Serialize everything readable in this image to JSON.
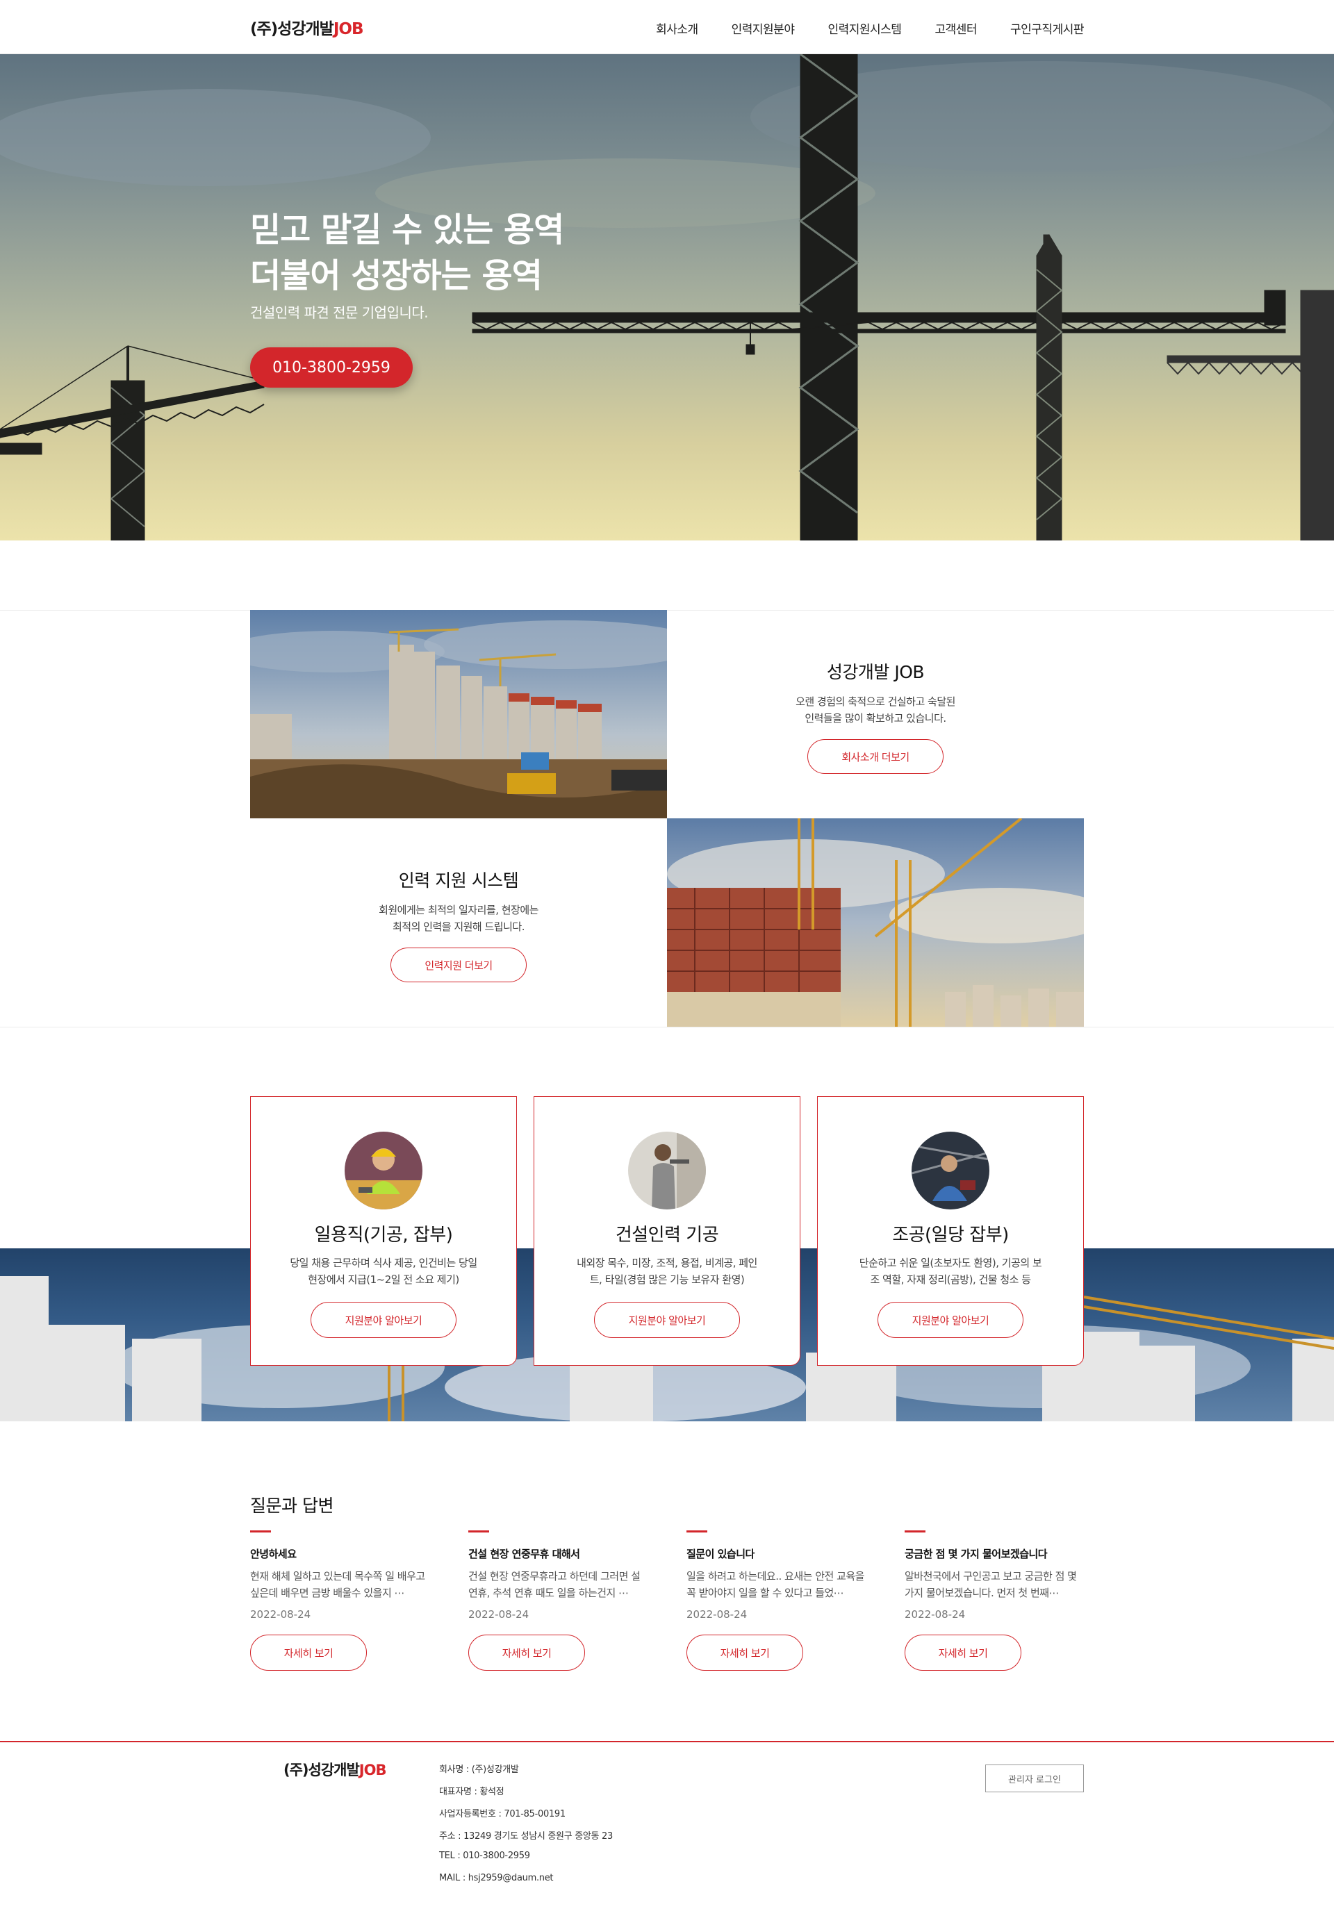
{
  "header": {
    "logo_main": "(주)성강개발",
    "logo_accent": "JOB",
    "nav": [
      "회사소개",
      "인력지원분야",
      "인력지원시스템",
      "고객센터",
      "구인구직게시판"
    ]
  },
  "hero": {
    "title_line1": "믿고 맡길 수 있는 용역",
    "title_line2": "더불어 성장하는 용역",
    "subtitle": "건설인력 파견 전문 기업입니다.",
    "phone_button": "010-3800-2959"
  },
  "intro": {
    "company": {
      "title": "성강개발 JOB",
      "line1": "오랜 경험의 축적으로 건실하고 숙달된",
      "line2": "인력들을 많이 확보하고 있습니다.",
      "button": "회사소개 더보기"
    },
    "system": {
      "title": "인력 지원 시스템",
      "line1": "회원에게는 최적의 일자리를, 현장에는",
      "line2": "최적의 인력을 지원해 드립니다.",
      "button": "인력지원 더보기"
    }
  },
  "fields": [
    {
      "title": "일용직(기공, 잡부)",
      "line1": "당일 채용 근무하며 식사 제공, 인건비는 당일",
      "line2": "현장에서 지급(1~2일 전 소요 제기)",
      "button": "지원분야 알아보기"
    },
    {
      "title": "건설인력 기공",
      "line1": "내외장 목수, 미장, 조적, 용접, 비계공, 페인",
      "line2": "트, 타일(경험 많은 기능 보유자 환영)",
      "button": "지원분야 알아보기"
    },
    {
      "title": "조공(일당 잡부)",
      "line1": "단순하고 쉬운 일(초보자도 환영), 기공의 보",
      "line2": "조 역할, 자재 정리(곰방), 건물 청소 등",
      "button": "지원분야 알아보기"
    }
  ],
  "qa": {
    "title": "질문과 답변",
    "items": [
      {
        "title": "안녕하세요",
        "body": "현재 해체 일하고 있는데 목수쪽 일 배우고 싶은데 배우면 금방 배울수 있을지 ⋯",
        "date": "2022-08-24",
        "button": "자세히 보기"
      },
      {
        "title": "건설 현장 연중무휴 대해서",
        "body": "건설 현장 연중무휴라고 하던데 그러면 설 연휴, 추석 연휴 때도 일을 하는건지 ⋯",
        "date": "2022-08-24",
        "button": "자세히 보기"
      },
      {
        "title": "질문이 있습니다",
        "body": "일을 하려고 하는데요.. 요새는 안전 교육을 꼭 받아야지 일을 할 수 있다고 들었⋯",
        "date": "2022-08-24",
        "button": "자세히 보기"
      },
      {
        "title": "궁금한 점 몇 가지 물어보겠습니다",
        "body": "알바천국에서 구인공고 보고 궁금한 점 몇 가지 물어보겠습니다. 먼저 첫 번째⋯",
        "date": "2022-08-24",
        "button": "자세히 보기"
      }
    ]
  },
  "footer": {
    "logo_main": "(주)성강개발",
    "logo_accent": "JOB",
    "info": [
      "회사명 : (주)성강개발",
      "대표자명 : 황석정",
      "사업자등록번호 : 701-85-00191",
      "주소 : 13249 경기도 성남시 중원구 중앙동 23",
      "TEL : 010-3800-2959",
      "MAIL : hsj2959@daum.net"
    ],
    "admin_button": "관리자 로그인"
  },
  "colors": {
    "accent": "#d3262b",
    "text": "#222222",
    "band": "#22436a"
  },
  "icons": [
    "crane-icon"
  ]
}
